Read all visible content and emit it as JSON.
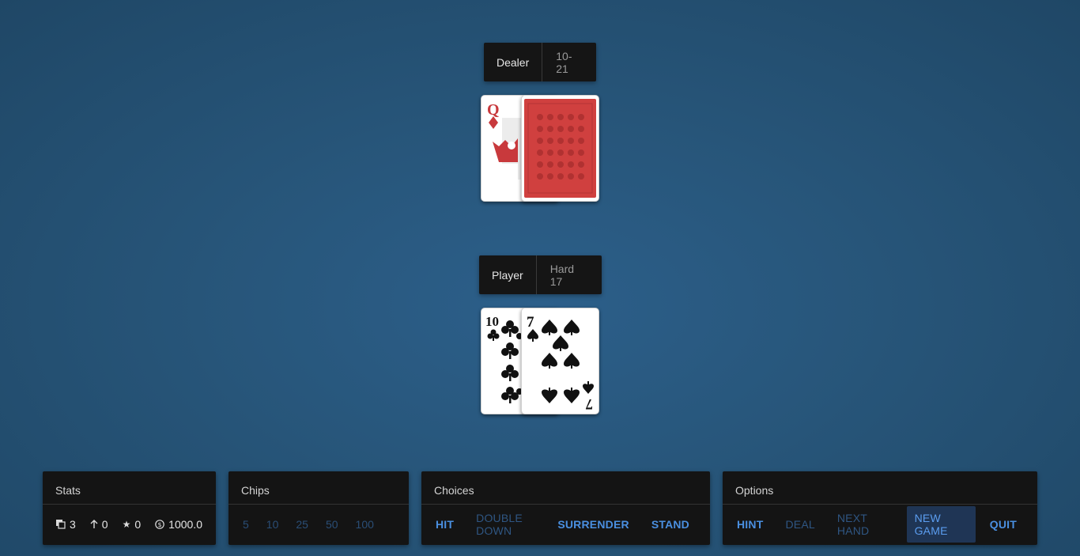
{
  "dealer": {
    "label": "Dealer",
    "score": "10-21"
  },
  "player": {
    "label": "Player",
    "score": "Hard 17"
  },
  "dealer_cards": [
    {
      "rank": "Q",
      "suit": "diamonds",
      "face_up": true
    },
    {
      "face_up": false
    }
  ],
  "player_cards": [
    {
      "rank": "10",
      "suit": "clubs",
      "face_up": true
    },
    {
      "rank": "7",
      "suit": "spades",
      "face_up": true
    }
  ],
  "stats": {
    "title": "Stats",
    "hands_icon": "cards-icon",
    "hands": "3",
    "wins_icon": "arrow-up-icon",
    "wins": "0",
    "blackjacks_icon": "star-icon",
    "blackjacks": "0",
    "bank_icon": "dollar-coin-icon",
    "bank": "1000.0"
  },
  "chips": {
    "title": "Chips",
    "values": [
      "5",
      "10",
      "25",
      "50",
      "100"
    ]
  },
  "choices": {
    "title": "Choices",
    "hit": "HIT",
    "double_down": "DOUBLE DOWN",
    "surrender": "SURRENDER",
    "stand": "STAND"
  },
  "options": {
    "title": "Options",
    "hint": "HINT",
    "deal": "DEAL",
    "next_hand": "NEXT HAND",
    "new_game": "NEW GAME",
    "quit": "QUIT"
  },
  "colors": {
    "table": "#275579",
    "panel": "#141414",
    "action_enabled": "#4a8fe0",
    "action_disabled": "#2f5683",
    "card_red": "#c8393c",
    "card_back": "#d0403f"
  }
}
